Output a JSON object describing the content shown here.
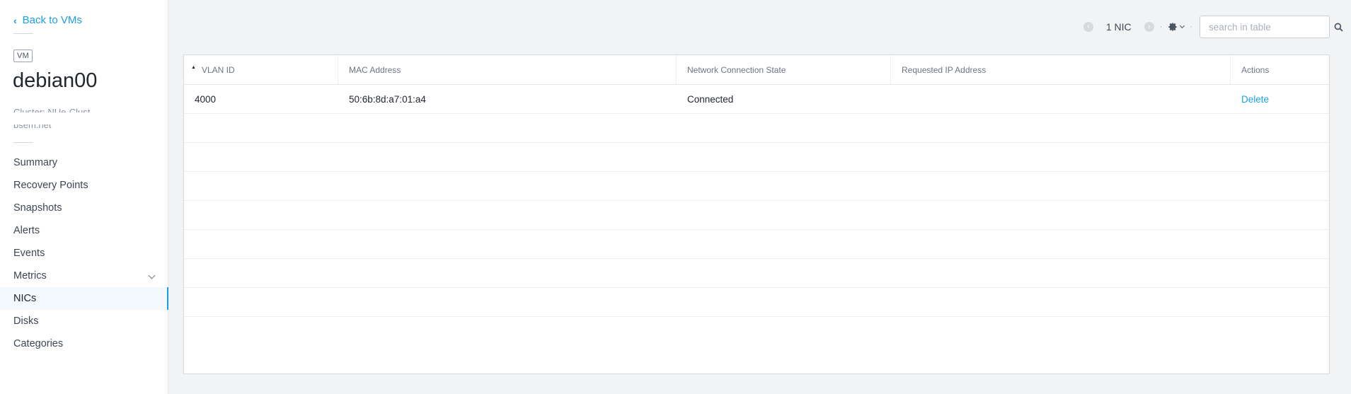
{
  "sidebar": {
    "back_label": "Back to VMs",
    "vm_badge": "VM",
    "vm_name": "debian00",
    "clipped_line1": "Cluster: NUe-Clust",
    "clipped_line2": "bsem.net",
    "items": [
      {
        "label": "Summary"
      },
      {
        "label": "Recovery Points"
      },
      {
        "label": "Snapshots"
      },
      {
        "label": "Alerts"
      },
      {
        "label": "Events"
      },
      {
        "label": "Metrics"
      },
      {
        "label": "NICs"
      },
      {
        "label": "Disks"
      },
      {
        "label": "Categories"
      }
    ],
    "active_item": "NICs"
  },
  "toolbar": {
    "count_label": "1 NIC",
    "search_placeholder": "search in table",
    "prev_icon": "chevron-left-circle-icon",
    "next_icon": "chevron-right-circle-icon",
    "settings_icon": "gear-icon"
  },
  "table": {
    "columns": [
      "VLAN ID",
      "MAC Address",
      "Network Connection State",
      "Requested IP Address",
      "Actions"
    ],
    "rows": [
      {
        "vlan_id": "4000",
        "mac": "50:6b:8d:a7:01:a4",
        "state": "Connected",
        "requested_ip": "",
        "action": "Delete"
      }
    ]
  },
  "colors": {
    "accent": "#1b9fe0",
    "page_bg": "#f2f3f5",
    "sidebar_bg": "#ffffff"
  }
}
